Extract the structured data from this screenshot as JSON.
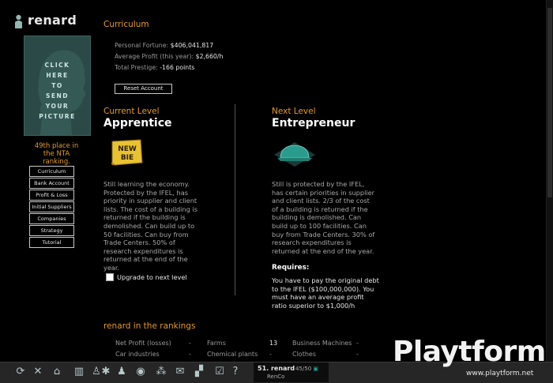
{
  "user": {
    "name": "renard"
  },
  "photo": {
    "text_lines": [
      "CLICK",
      "HERE",
      "TO",
      "SEND",
      "YOUR",
      "PICTURE"
    ]
  },
  "sidebar": {
    "rank_text": [
      "49th place in",
      "the NTA",
      "ranking."
    ],
    "buttons": [
      "Curriculum",
      "Bank Account",
      "Profit & Loss",
      "Initial Suppliers",
      "Companies",
      "Strategy",
      "Tutorial"
    ]
  },
  "curriculum": {
    "title": "Curriculum",
    "fortune_label": "Personal Fortune:",
    "fortune_value": "$406,041,817",
    "profit_label": "Average Profit (this year):",
    "profit_value": "$2,660/h",
    "prestige_label": "Total Prestige:",
    "prestige_value": "-166 points",
    "reset_label": "Reset Account"
  },
  "current_level": {
    "heading": "Current Level",
    "name": "Apprentice",
    "badge_text": [
      "NEW",
      "BIE"
    ],
    "description": "Still learning the economy. Protected by the IFEL, has priority in supplier and client lists. The cost of a building is returned if the building is demolished. Can build up to 50 facilities. Can buy from Trade Centers. 50% of research expenditures is returned at the end of the year.",
    "upgrade_label": "Upgrade to next level"
  },
  "next_level": {
    "heading": "Next Level",
    "name": "Entrepreneur",
    "description": "Still is protected by the IFEL, has certain priorities in supplier and client lists. 2/3 of the cost of a building is returned if the building is demolished. Can build up to 100 facilities. Can buy from Trade Centers. 30% of research expenditures is returned at the end of the year.",
    "requires_title": "Requires:",
    "requires_text": "You have to pay the original debt to the IFEL ($100,000,000). You must have an average profit ratio superior to $1,000/h"
  },
  "rankings": {
    "title": "renard in the rankings",
    "rows": [
      [
        {
          "label": "Net Profit (losses)",
          "value": "-"
        },
        {
          "label": "Farms",
          "value": "13"
        },
        {
          "label": "Business Machines",
          "value": "-"
        }
      ],
      [
        {
          "label": "Car industries",
          "value": "-"
        },
        {
          "label": "Chemical plants",
          "value": "-"
        },
        {
          "label": "Clothes",
          "value": "-"
        }
      ]
    ]
  },
  "toolbar": {
    "icons": [
      "refresh-icon",
      "close-icon",
      "home-icon",
      "building-icon",
      "user-icon",
      "spider-icon",
      "people-icon",
      "eye-icon",
      "network-icon",
      "mail-icon",
      "check-icon",
      "help-icon"
    ]
  },
  "company": {
    "rank_name": "51. renard",
    "count": "45/50",
    "sub": "RenCo"
  },
  "watermark": {
    "text": "Playtform",
    "url": "www.playtform.net"
  },
  "colors": {
    "accent": "#e39a2a",
    "photo_bg": "#2b4a47",
    "badge_yellow": "#e8c231",
    "badge_teal": "#2a9c8e"
  }
}
